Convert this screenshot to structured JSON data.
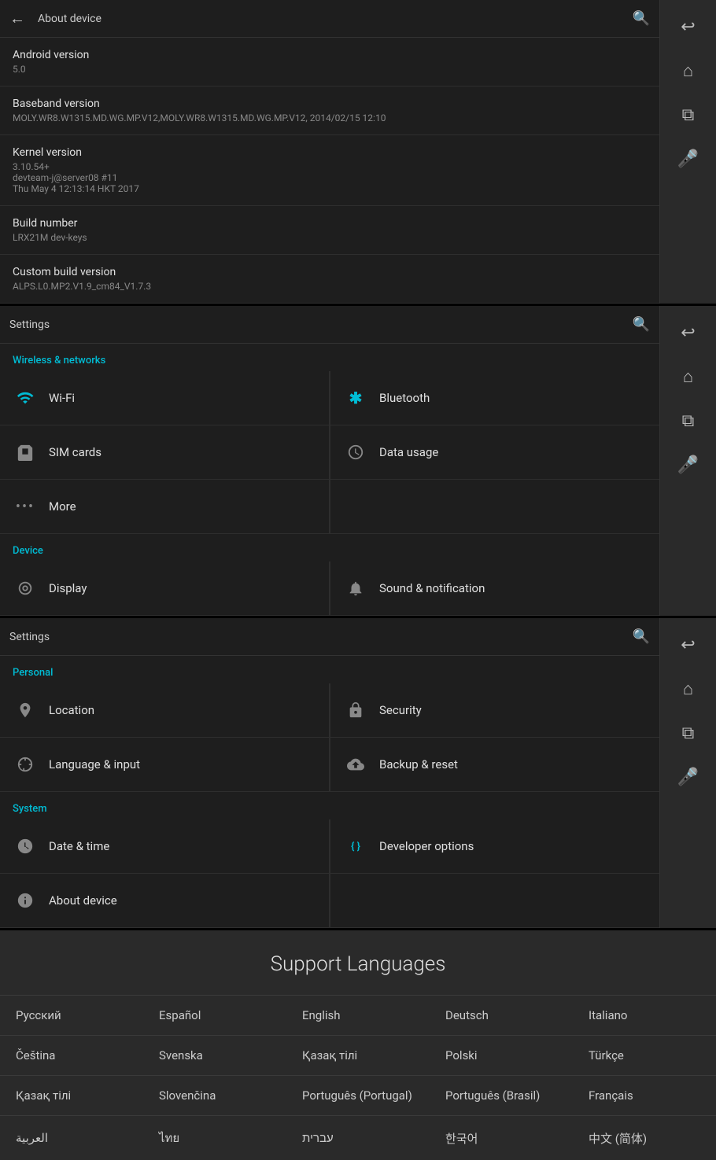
{
  "panel1": {
    "header": {
      "back_icon": "←",
      "title": "About device",
      "search_icon": "🔍"
    },
    "items": [
      {
        "title": "Android version",
        "value": "5.0"
      },
      {
        "title": "Baseband version",
        "value": "MOLY.WR8.W1315.MD.WG.MP.V12,MOLY.WR8.W1315.MD.WG.MP.V12, 2014/02/15 12:10"
      },
      {
        "title": "Kernel version",
        "value": "3.10.54+\ndevteam-j@server08 #11\nThu May 4 12:13:14 HKT 2017"
      },
      {
        "title": "Build number",
        "value": "LRX21M dev-keys"
      },
      {
        "title": "Custom build version",
        "value": "ALPS.L0.MP2.V1.9_cm84_V1.7.3"
      }
    ],
    "sidebar": {
      "buttons": [
        "↩",
        "⌂",
        "⧉",
        "🎤"
      ]
    }
  },
  "panel2": {
    "header": {
      "title": "Settings",
      "search_icon": "🔍"
    },
    "section_wireless": "Wireless & networks",
    "section_device": "Device",
    "items_wireless": [
      {
        "icon": "wifi",
        "label": "Wi-Fi"
      },
      {
        "icon": "bt",
        "label": "Bluetooth"
      },
      {
        "icon": "sim",
        "label": "SIM cards"
      },
      {
        "icon": "data",
        "label": "Data usage"
      },
      {
        "icon": "more",
        "label": "More"
      }
    ],
    "items_device": [
      {
        "icon": "display",
        "label": "Display"
      },
      {
        "icon": "sound",
        "label": "Sound & notification"
      }
    ],
    "sidebar": {
      "buttons": [
        "↩",
        "⌂",
        "⧉",
        "🎤"
      ]
    }
  },
  "panel3": {
    "header": {
      "title": "Settings",
      "search_icon": "🔍"
    },
    "section_personal": "Personal",
    "section_system": "System",
    "items_personal": [
      {
        "icon": "location",
        "label": "Location"
      },
      {
        "icon": "security",
        "label": "Security"
      },
      {
        "icon": "language",
        "label": "Language & input"
      },
      {
        "icon": "backup",
        "label": "Backup & reset"
      }
    ],
    "items_system": [
      {
        "icon": "date",
        "label": "Date & time"
      },
      {
        "icon": "dev",
        "label": "Developer options"
      },
      {
        "icon": "about",
        "label": "About device"
      }
    ],
    "sidebar": {
      "buttons": [
        "↩",
        "⌂",
        "⧉",
        "🎤"
      ]
    }
  },
  "support_languages": {
    "title": "Support Languages",
    "rows": [
      [
        "Русский",
        "Español",
        "English",
        "Deutsch",
        "Italiano"
      ],
      [
        "Čeština",
        "Svenska",
        "Қазақ тілі",
        "Polski",
        "Türkçe"
      ],
      [
        "Қазақ тілі",
        "Slovenčina",
        "Português (Portugal)",
        "Português (Brasil)",
        "Français"
      ],
      [
        "العربية",
        "ไทย",
        "עברית",
        "한국어",
        "中文 (简体)"
      ]
    ]
  }
}
